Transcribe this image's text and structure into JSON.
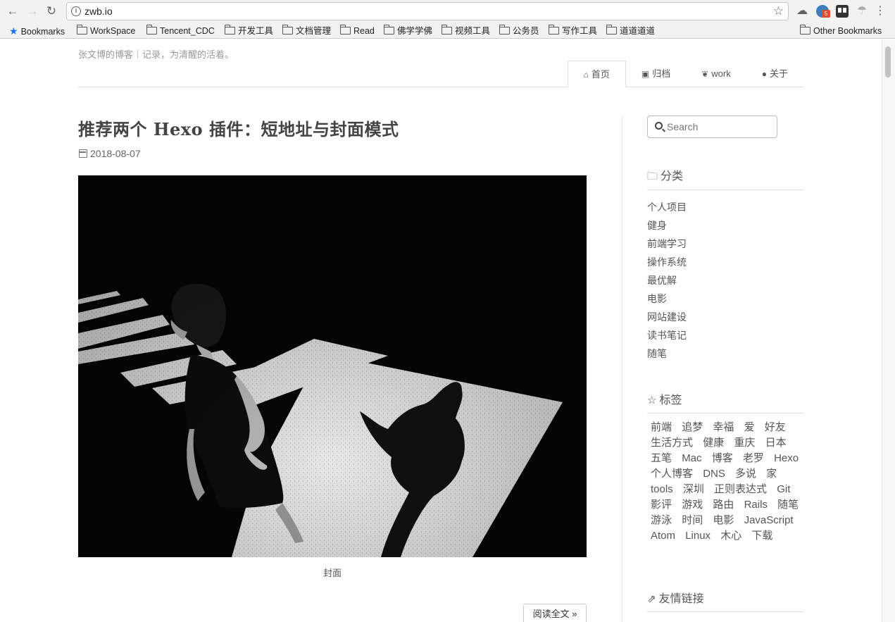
{
  "browser": {
    "url": "zwb.io",
    "bookmarks": [
      "Bookmarks",
      "WorkSpace",
      "Tencent_CDC",
      "开发工具",
      "文档管理",
      "Read",
      "佛学学佛",
      "视频工具",
      "公务员",
      "写作工具",
      "道道道道"
    ],
    "other_bookmarks": "Other Bookmarks",
    "extension_badge": "5"
  },
  "site": {
    "description": "张文博的博客｜记录，为清醒的活着。"
  },
  "nav": {
    "tabs": [
      {
        "label": "首页",
        "icon": "home-icon",
        "active": true
      },
      {
        "label": "归档",
        "icon": "archive-icon",
        "active": false
      },
      {
        "label": "work",
        "icon": "leaf-icon",
        "active": false
      },
      {
        "label": "关于",
        "icon": "user-icon",
        "active": false
      }
    ]
  },
  "post": {
    "title": "推荐两个 Hexo 插件：短地址与封面模式",
    "date": "2018-08-07",
    "caption": "封面",
    "read_more": "阅读全文 »"
  },
  "sidebar": {
    "search_placeholder": "Search",
    "categories_title": "分类",
    "categories": [
      "个人项目",
      "健身",
      "前端学习",
      "操作系统",
      "最优解",
      "电影",
      "网站建设",
      "读书笔记",
      "随笔"
    ],
    "tags_title": "标签",
    "tags": [
      "前端",
      "追梦",
      "幸福",
      "爱",
      "好友",
      "生活方式",
      "健康",
      "重庆",
      "日本",
      "五笔",
      "Mac",
      "博客",
      "老罗",
      "Hexo",
      "个人博客",
      "DNS",
      "多说",
      "家",
      "tools",
      "深圳",
      "正则表达式",
      "Git",
      "影评",
      "游戏",
      "路由",
      "Rails",
      "随笔",
      "游泳",
      "时间",
      "电影",
      "JavaScript",
      "Atom",
      "Linux",
      "木心",
      "下载"
    ],
    "links_title": "友情链接"
  },
  "colors": {
    "accent_blue": "#1a73e8",
    "text_main": "#333333",
    "text_muted": "#999999"
  }
}
